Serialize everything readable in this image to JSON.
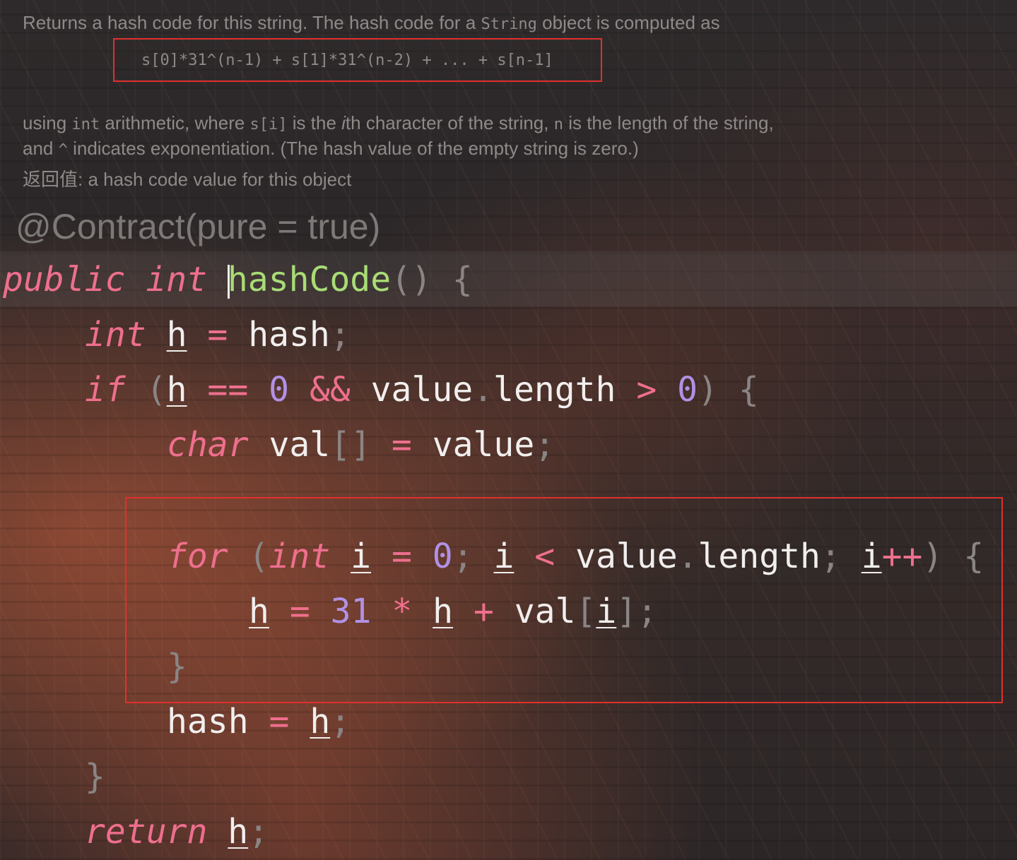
{
  "doc": {
    "line1_a": "Returns a hash code for this string. The hash code for a ",
    "line1_code": "String",
    "line1_b": " object is computed as",
    "formula": "s[0]*31^(n-1) + s[1]*31^(n-2) + ... + s[n-1]",
    "line2_a": "using ",
    "line2_code1": "int",
    "line2_b": " arithmetic, where ",
    "line2_code2": "s[i]",
    "line2_c": " is the ",
    "line2_italic": "i",
    "line2_d": "th character of the string, ",
    "line2_code3": "n",
    "line2_e": " is the length of the string,",
    "line3_a": "and ",
    "line3_code": "^",
    "line3_b": " indicates exponentiation. (The hash value of the empty string is zero.)",
    "line4": "返回值: a hash code value for this object"
  },
  "annotation": "@Contract(pure = true)",
  "code": {
    "l1": {
      "k1": "public",
      "k2": "int",
      "fn": "hashCode",
      "p": "()",
      "b": "{"
    },
    "l2": {
      "k": "int",
      "v": "h",
      "eq": "=",
      "rhs": "hash",
      "semi": ";"
    },
    "l3": {
      "k": "if",
      "po": "(",
      "v": "h",
      "op1": "==",
      "n1": "0",
      "op2": "&&",
      "obj": "value",
      "dot": ".",
      "prop": "length",
      "op3": ">",
      "n2": "0",
      "pc": ")",
      "b": "{"
    },
    "l4": {
      "k": "char",
      "name": "val",
      "br": "[]",
      "eq": "=",
      "rhs": "value",
      "semi": ";"
    },
    "l5": {
      "k": "for",
      "po": "(",
      "k2": "int",
      "v1": "i",
      "eq": "=",
      "n": "0",
      "s1": ";",
      "v2": "i",
      "lt": "<",
      "obj": "value",
      "dot": ".",
      "prop": "length",
      "s2": ";",
      "v3": "i",
      "inc": "++",
      "pc": ")",
      "b": "{"
    },
    "l6": {
      "v1": "h",
      "eq": "=",
      "n": "31",
      "mul": "*",
      "v2": "h",
      "plus": "+",
      "arr": "val",
      "bo": "[",
      "v3": "i",
      "bc": "]",
      "semi": ";"
    },
    "l7": {
      "b": "}"
    },
    "l8": {
      "lhs": "hash",
      "eq": "=",
      "v": "h",
      "semi": ";"
    },
    "l9": {
      "b": "}"
    },
    "l10": {
      "k": "return",
      "v": "h",
      "semi": ";"
    }
  },
  "colors": {
    "keyword": "#ee6f8d",
    "function": "#a9dc76",
    "number": "#b191e5",
    "highlight_box": "#e0302d"
  }
}
